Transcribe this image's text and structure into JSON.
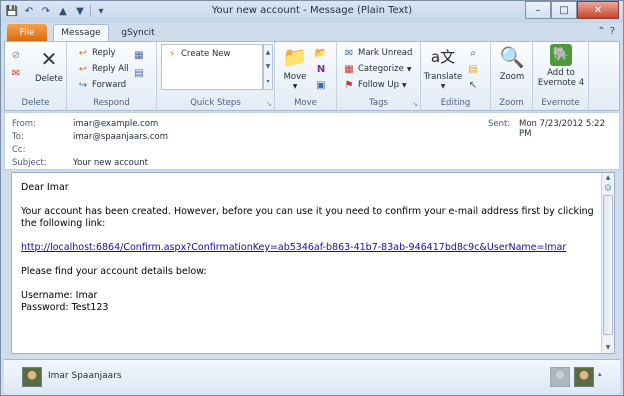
{
  "window": {
    "title": "Your new account - Message (Plain Text)",
    "controls": {
      "minimize": "–",
      "maximize": "□",
      "close": "✕"
    }
  },
  "quick_access": [
    "save-icon",
    "undo-icon",
    "redo-icon",
    "up-icon",
    "down-icon"
  ],
  "tabs": [
    {
      "label": "File",
      "active": false
    },
    {
      "label": "Message",
      "active": true
    },
    {
      "label": "gSyncit",
      "active": false
    }
  ],
  "ribbon": {
    "delete_group": {
      "label": "Delete",
      "delete_label": "Delete"
    },
    "respond_group": {
      "label": "Respond",
      "reply": "Reply",
      "reply_all": "Reply All",
      "forward": "Forward"
    },
    "quick_steps_group": {
      "label": "Quick Steps",
      "create_new": "Create New"
    },
    "move_group": {
      "label": "Move",
      "move": "Move"
    },
    "tags_group": {
      "label": "Tags",
      "mark_unread": "Mark Unread",
      "categorize": "Categorize",
      "follow_up": "Follow Up"
    },
    "editing_group": {
      "label": "Editing",
      "translate": "Translate"
    },
    "zoom_group": {
      "label": "Zoom",
      "zoom": "Zoom"
    },
    "evernote_group": {
      "label": "Evernote",
      "add_line1": "Add to",
      "add_line2": "Evernote 4"
    }
  },
  "header": {
    "from_label": "From:",
    "from_value": "imar@example.com",
    "to_label": "To:",
    "to_value": "imar@spaanjaars.com",
    "cc_label": "Cc:",
    "cc_value": "",
    "subject_label": "Subject:",
    "subject_value": "Your new account",
    "sent_label": "Sent:",
    "sent_value": "Mon 7/23/2012 5:22 PM"
  },
  "body": {
    "greeting": "Dear Imar",
    "para1": "Your account has been created. However, before you can use it you need to confirm your e-mail address first by clicking the following link:",
    "link": "http://localhost:6864/Confirm.aspx?ConfirmationKey=ab5346af-b863-41b7-83ab-946417bd8c9c&UserName=Imar",
    "para2": "Please find your account details below:",
    "username_line": "Username: Imar",
    "password_line": "Password: Test123"
  },
  "people_pane": {
    "name": "Imar Spaanjaars"
  }
}
